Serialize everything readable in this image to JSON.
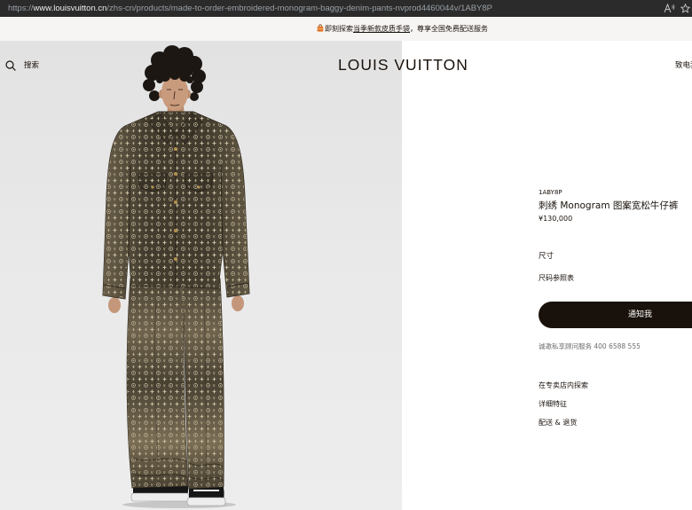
{
  "browser": {
    "url_scheme": "https://",
    "url_host": "www.louisvuitton.cn",
    "url_path": "/zhs-cn/products/made-to-order-embroidered-monogram-baggy-denim-pants-nvprod4460044v/1ABY8P",
    "read_aloud_icon": "read-aloud-icon",
    "favorite_icon": "star-outline-icon"
  },
  "promo_banner": {
    "icon": "shopping-bag-icon",
    "text_before": "即刻探索",
    "link_text": "当季新款皮质手袋",
    "text_after": "，尊享全国免费配送服务"
  },
  "header": {
    "search_icon": "search-icon",
    "search_label": "搜索",
    "logo": "LOUIS VUITTON",
    "contact_label": "致电我"
  },
  "product": {
    "sku": "1ABY8P",
    "name": "刺绣 Monogram 图案宽松牛仔裤",
    "price": "¥130,000",
    "size_label": "尺寸",
    "size_guide_label": "尺码参照表",
    "notify_button_label": "通知我",
    "advisor_text": "诚邀私享顾问服务 400 6588 555",
    "links": [
      "在专卖店内探索",
      "详细特征",
      "配送 & 退货"
    ]
  },
  "colors": {
    "brand_dark": "#19110b",
    "browser_bar": "#2b2b2b",
    "banner_background": "#f6f5f3",
    "image_background": "#e9e9e9",
    "secondary_text": "#6d6d6d",
    "banner_icon": "#e0772d"
  }
}
